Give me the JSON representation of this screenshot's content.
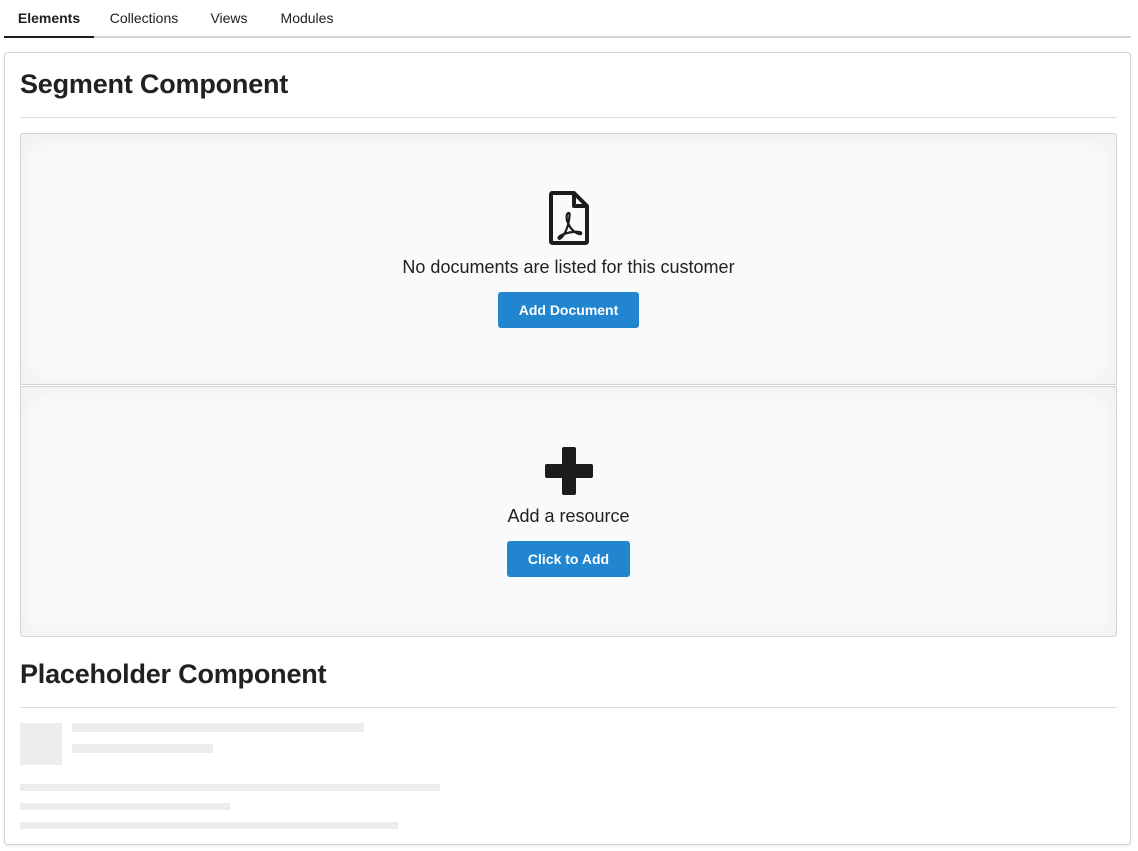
{
  "tabs": [
    {
      "label": "Elements",
      "active": true
    },
    {
      "label": "Collections",
      "active": false
    },
    {
      "label": "Views",
      "active": false
    },
    {
      "label": "Modules",
      "active": false
    }
  ],
  "segment_section": {
    "title": "Segment Component",
    "panels": [
      {
        "icon": "file-pdf-icon",
        "message": "No documents are listed for this customer",
        "button_label": "Add Document"
      },
      {
        "icon": "plus-icon",
        "message": "Add a resource",
        "button_label": "Click to Add"
      }
    ]
  },
  "placeholder_section": {
    "title": "Placeholder Component"
  },
  "colors": {
    "primary": "#2185d0",
    "placeholder": "#ececec",
    "segment_bg": "#f9fafb",
    "text": "#212121"
  }
}
